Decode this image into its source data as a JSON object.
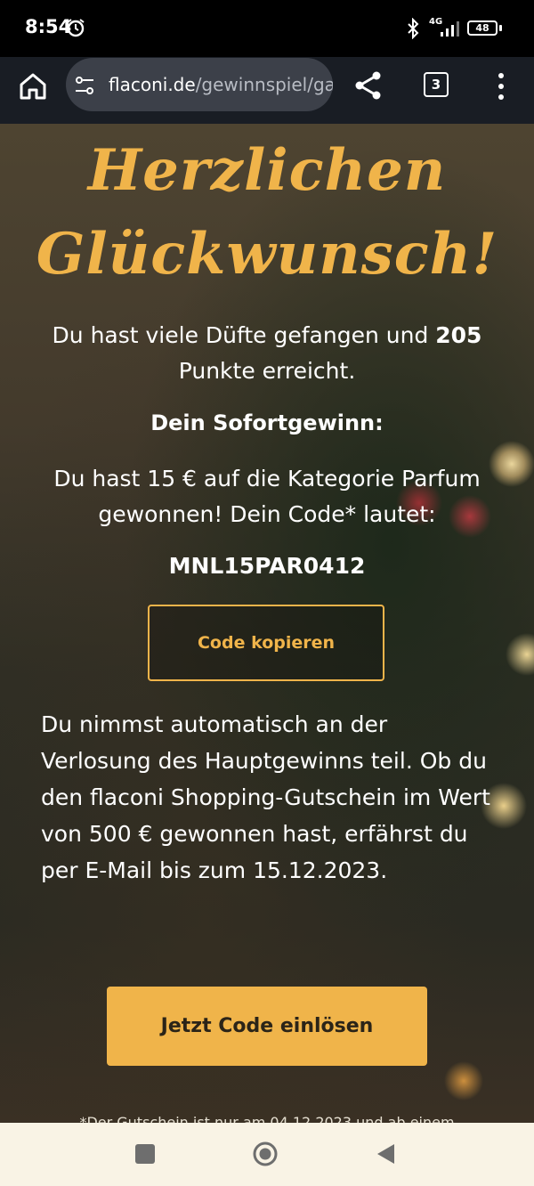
{
  "status_bar": {
    "time": "8:54",
    "network": "4G",
    "battery": "48",
    "icons": [
      "alarm-icon",
      "bluetooth-icon",
      "signal-icon",
      "battery-icon"
    ]
  },
  "browser": {
    "url_domain": "flaconi.de",
    "url_path": "/gewinnspiel/ga",
    "tab_count": "3",
    "icons": [
      "home-icon",
      "tune-icon",
      "share-icon",
      "tab-switcher-icon",
      "more-vert-icon"
    ]
  },
  "content": {
    "headline_line1": "Herzlichen",
    "headline_line2": "Glückwunsch!",
    "intro_before": "Du hast viele Düfte gefangen und ",
    "intro_points": "205",
    "intro_after": "Punkte erreicht.",
    "instant_title": "Dein Sofortgewinn:",
    "win_text": "Du hast 15 € auf die Kategorie Parfum gewonnen! Dein Code* lautet:",
    "code": "MNL15PAR0412",
    "copy_button": "Code kopieren",
    "raffle_text": "Du nimmst automatisch an der Verlosung des Hauptgewinns teil. Ob du den flaconi Shopping-Gutschein im Wert von 500 € gewonnen hast, erfährst du per E-Mail bis zum 15.12.2023.",
    "redeem_button": "Jetzt Code einlösen",
    "footnote": "*Der Gutschein ist nur am 04.12.2023 und ab einem"
  },
  "colors": {
    "accent": "#f0b44a",
    "toolbar": "#191d24",
    "nav_bar": "#f9f3e5"
  },
  "nav_bar": {
    "icons": [
      "recents-icon",
      "home-icon",
      "back-icon"
    ]
  }
}
